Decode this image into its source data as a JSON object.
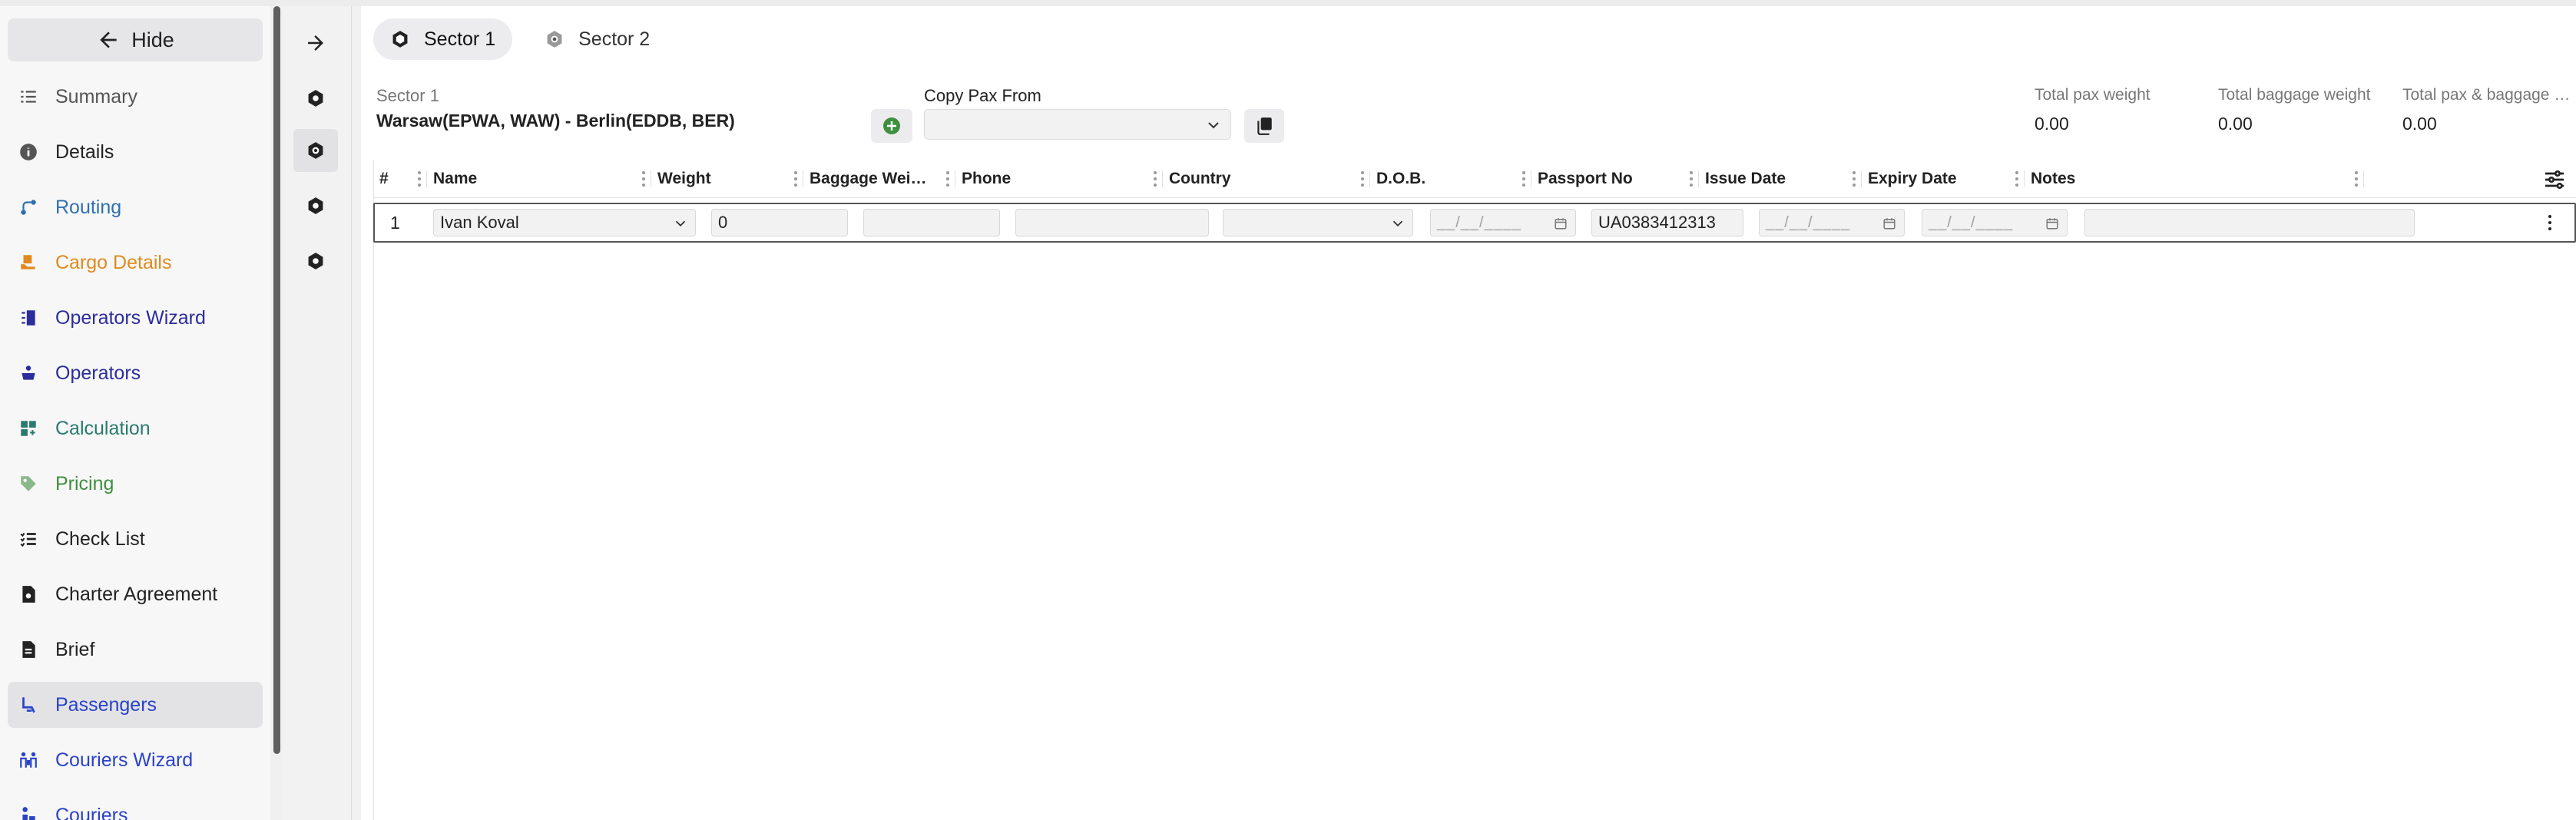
{
  "sidebar": {
    "hide_label": "Hide",
    "items": [
      {
        "label": "Summary",
        "icon": "list-icon",
        "color": "#555555"
      },
      {
        "label": "Details",
        "icon": "info-icon",
        "color": "#222222"
      },
      {
        "label": "Routing",
        "icon": "route-icon",
        "color": "#2f6fb0"
      },
      {
        "label": "Cargo Details",
        "icon": "cargo-icon",
        "color": "#e08a1e"
      },
      {
        "label": "Operators Wizard",
        "icon": "operators-wizard-icon",
        "color": "#2c2c9c"
      },
      {
        "label": "Operators",
        "icon": "operators-icon",
        "color": "#2c2c9c"
      },
      {
        "label": "Calculation",
        "icon": "calculation-icon",
        "color": "#2a7a6e"
      },
      {
        "label": "Pricing",
        "icon": "tag-icon",
        "color": "#3f8f3f"
      },
      {
        "label": "Check List",
        "icon": "checklist-icon",
        "color": "#222222"
      },
      {
        "label": "Charter Agreement",
        "icon": "document-icon",
        "color": "#222222"
      },
      {
        "label": "Brief",
        "icon": "brief-icon",
        "color": "#222222"
      },
      {
        "label": "Passengers",
        "icon": "seat-icon",
        "color": "#2a42c8"
      },
      {
        "label": "Couriers Wizard",
        "icon": "couriers-wizard-icon",
        "color": "#2a42c8"
      },
      {
        "label": "Couriers",
        "icon": "courier-icon",
        "color": "#2a42c8"
      }
    ],
    "active_index": 11
  },
  "tabs": [
    {
      "label": "Sector 1",
      "active": true
    },
    {
      "label": "Sector 2",
      "active": false
    }
  ],
  "sector": {
    "label": "Sector 1",
    "route": "Warsaw(EPWA, WAW) - Berlin(EDDB, BER)"
  },
  "copy_pax": {
    "label": "Copy Pax From",
    "value": ""
  },
  "stats": [
    {
      "label": "Total pax weight",
      "value": "0.00"
    },
    {
      "label": "Total baggage weight",
      "value": "0.00"
    },
    {
      "label": "Total pax & baggage weight",
      "value": "0.00"
    }
  ],
  "grid": {
    "columns": [
      "#",
      "Name",
      "Weight",
      "Baggage Weight",
      "Phone",
      "Country",
      "D.O.B.",
      "Passport No",
      "Issue Date",
      "Expiry Date",
      "Notes"
    ],
    "rows": [
      {
        "num": "1",
        "name": "Ivan Koval",
        "weight": "0",
        "baggage_weight": "",
        "phone": "",
        "country": "",
        "dob": "__/__/____",
        "passport_no": "UA0383412313",
        "issue_date": "__/__/____",
        "expiry_date": "__/__/____",
        "notes": ""
      }
    ]
  }
}
